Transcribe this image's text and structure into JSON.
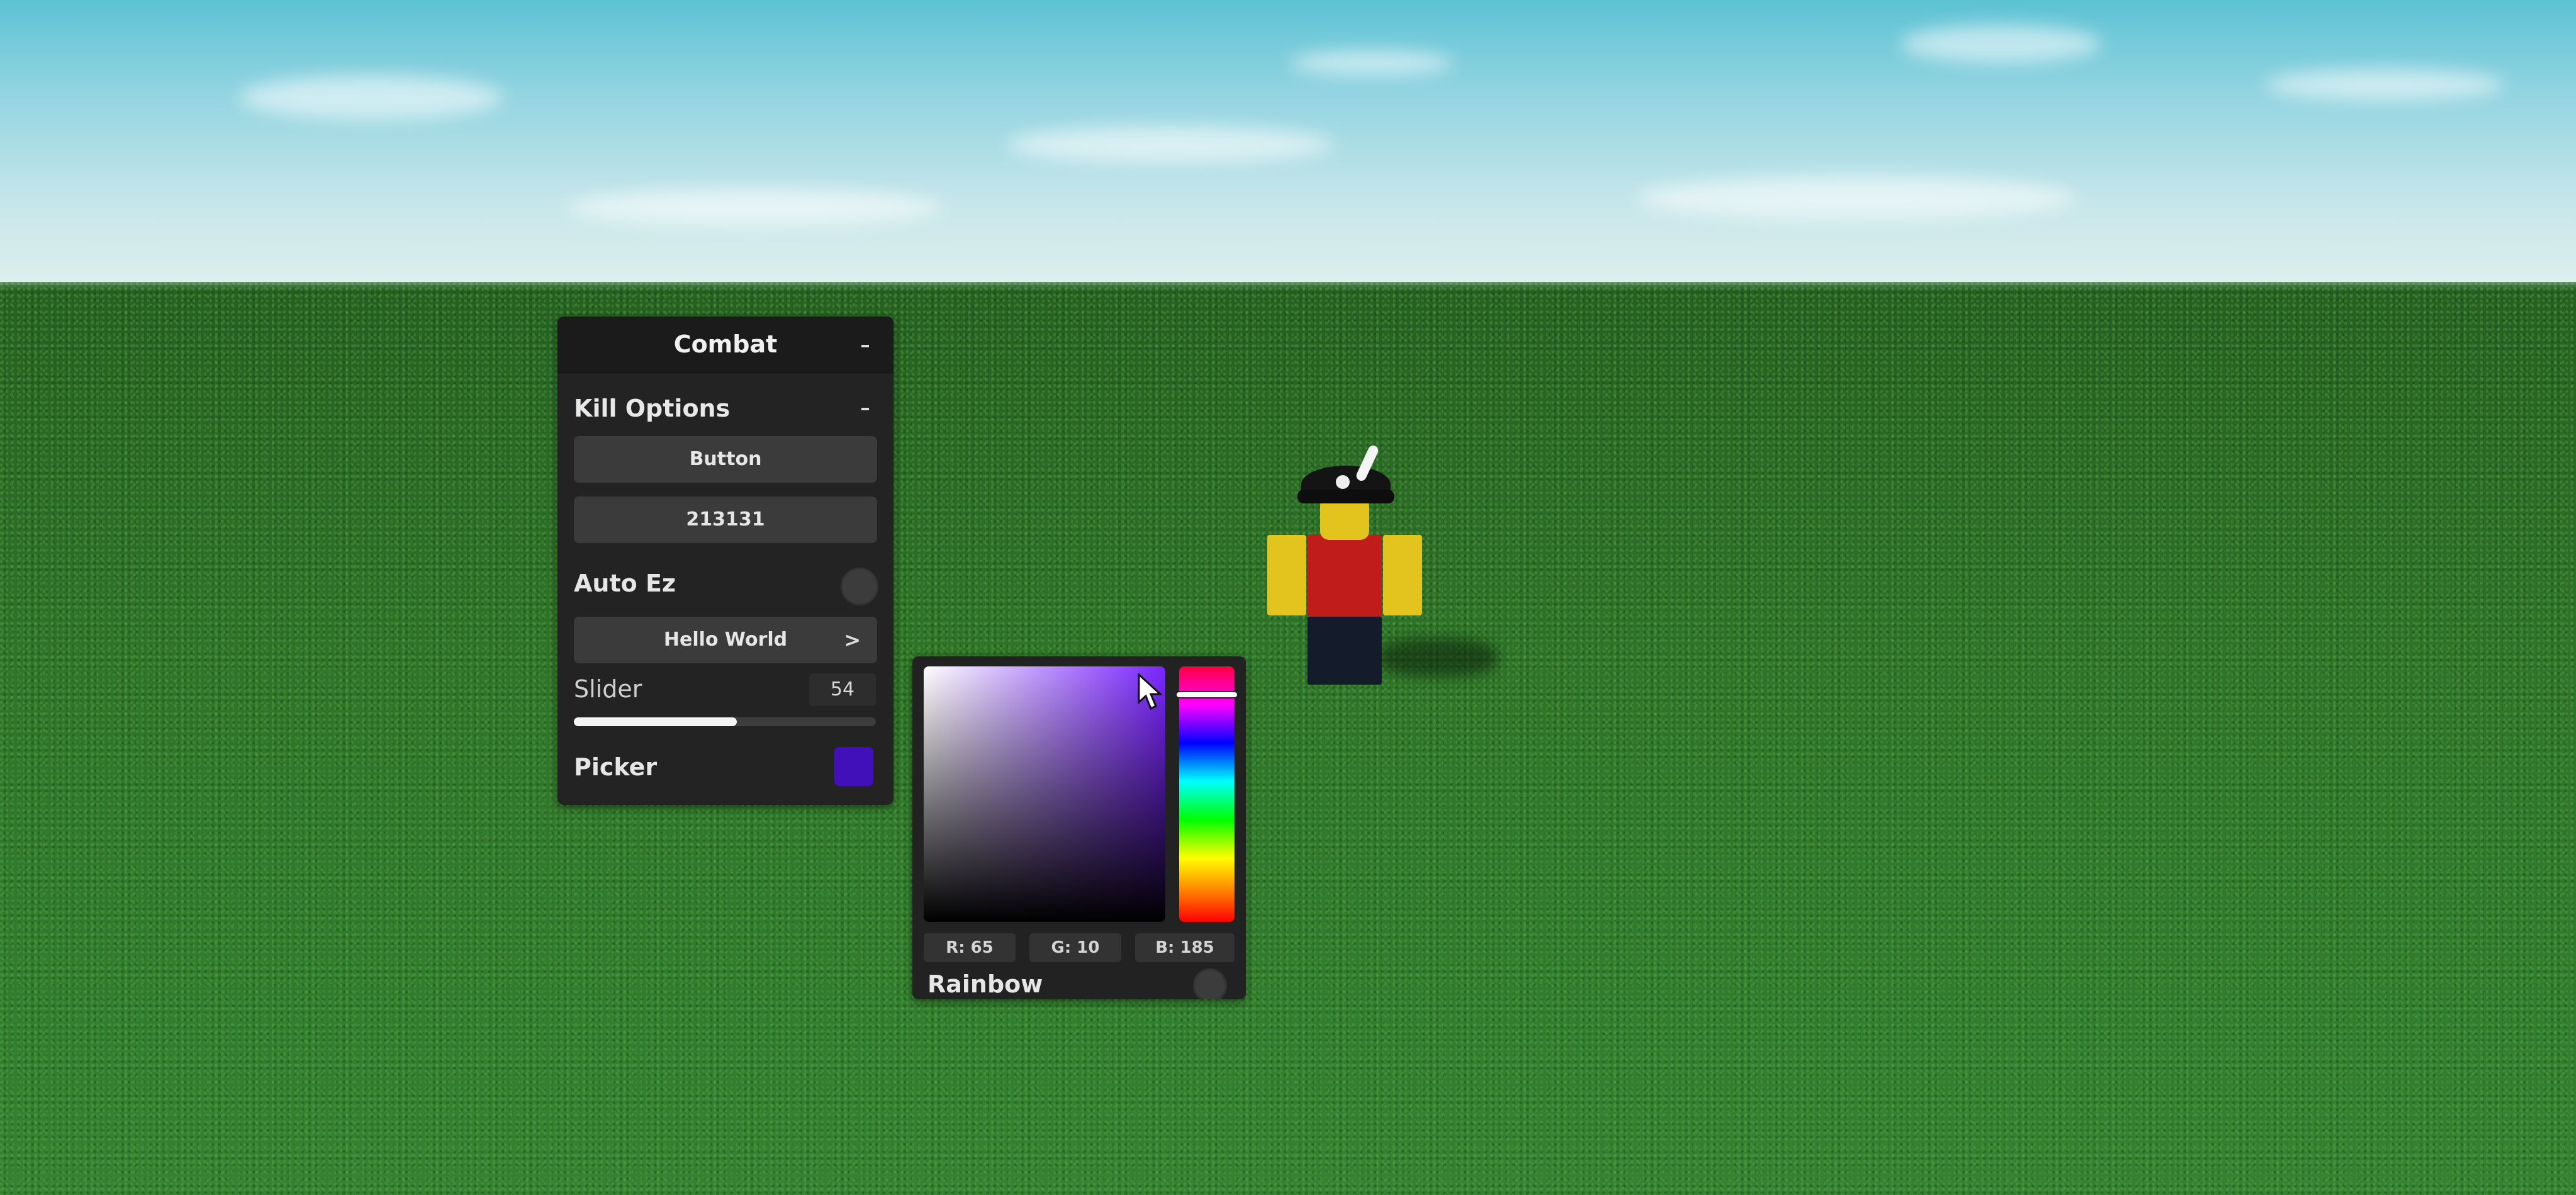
{
  "panel": {
    "title": "Combat",
    "collapse_icon": "chevron-up-icon",
    "section": {
      "title": "Kill Options",
      "collapse_icon": "chevron-up-icon",
      "button_label": "Button",
      "textbox_value": "213131",
      "toggle_label": "Auto Ez",
      "toggle_state": "off",
      "dropdown_label": "Hello World",
      "dropdown_icon": ">",
      "slider_label": "Slider",
      "slider_value": "54",
      "slider_fraction": 0.54,
      "picker_label": "Picker",
      "picker_color": "#4110b9"
    }
  },
  "color_picker": {
    "r_label": "R: 65",
    "g_label": "G: 10",
    "b_label": "B: 185",
    "rainbow_label": "Rainbow",
    "rainbow_state": "off",
    "sv_hue_color": "#7a25ff",
    "hue_position_fraction": 0.11
  },
  "colors": {
    "panel_bg": "#232323",
    "header_bg": "#1b1b1b",
    "button_bg": "#3b3b3b",
    "text": "#e6e6e6",
    "sky": "#8fd3e0",
    "ground": "#2e6f28"
  }
}
